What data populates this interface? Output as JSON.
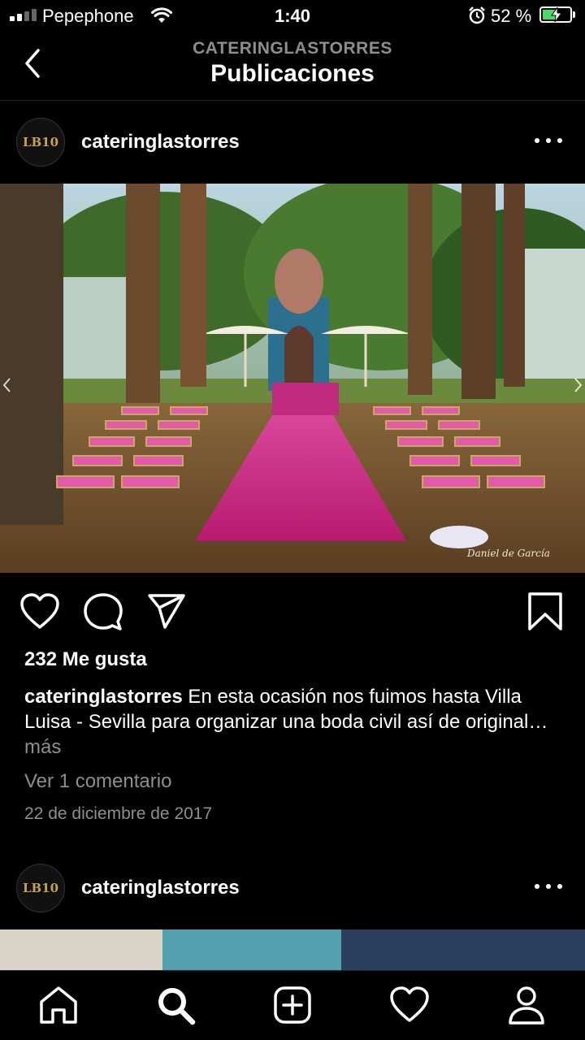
{
  "status_bar": {
    "carrier": "Pepephone",
    "time": "1:40",
    "battery_percent": "52 %",
    "battery_level": 0.52,
    "signal_bars": 4,
    "signal_bars_filled": 2,
    "icons": [
      "signal-icon",
      "wifi-icon",
      "alarm-icon",
      "battery-charging-icon"
    ]
  },
  "header": {
    "subtitle": "CATERINGLASTORRES",
    "title": "Publicaciones",
    "back_icon": "chevron-left-icon"
  },
  "posts": [
    {
      "username": "cateringlastorres",
      "avatar_logo_text": "LB10",
      "more_icon": "more-horizontal-icon",
      "image_watermark": "Daniel de García",
      "likes": "232 Me gusta",
      "caption_user": "cateringlastorres",
      "caption_text": " En esta ocasión nos fuimos hasta Villa Luisa - Sevilla para organizar una boda civil así de original…",
      "caption_more": " más",
      "comments_link": "Ver 1 comentario",
      "date": "22 de diciembre de 2017",
      "action_icons": [
        "heart-icon",
        "comment-icon",
        "share-icon",
        "bookmark-icon"
      ]
    },
    {
      "username": "cateringlastorres",
      "avatar_logo_text": "LB10",
      "more_icon": "more-horizontal-icon"
    }
  ],
  "tab_bar": {
    "tabs": [
      "home-icon",
      "search-icon",
      "add-post-icon",
      "activity-heart-icon",
      "profile-icon"
    ],
    "active_tab": "search-icon"
  },
  "colors": {
    "background": "#000000",
    "text_primary": "#ffffff",
    "text_secondary": "#8e8e8e",
    "battery_fill": "#4cd964",
    "carpet_magenta": "#cc1f7a"
  }
}
